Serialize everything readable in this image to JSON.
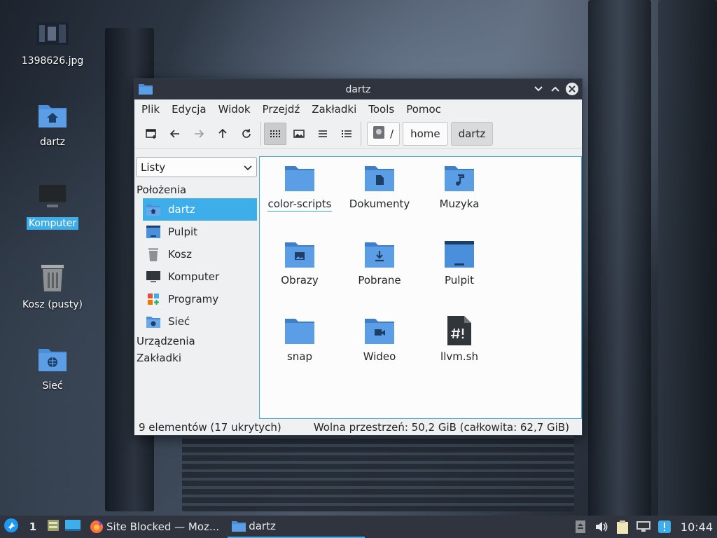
{
  "desktop": {
    "icons": [
      {
        "label": "1398626.jpg",
        "icon": "image-thumbnail-icon"
      },
      {
        "label": "dartz",
        "icon": "home-folder-icon"
      },
      {
        "label": "Komputer",
        "icon": "computer-icon",
        "selected": true
      },
      {
        "label": "Kosz (pusty)",
        "icon": "trash-icon"
      },
      {
        "label": "Sieć",
        "icon": "network-folder-icon"
      }
    ]
  },
  "window": {
    "title": "dartz",
    "menu": [
      "Plik",
      "Edycja",
      "Widok",
      "Przejdź",
      "Zakładki",
      "Tools",
      "Pomoc"
    ],
    "breadcrumb": [
      "/",
      "home",
      "dartz"
    ],
    "side_mode": "Listy",
    "side_sections": {
      "places": "Położenia",
      "devices": "Urządzenia",
      "bookmarks": "Zakładki"
    },
    "places": [
      {
        "label": "dartz",
        "icon": "home-folder-icon",
        "selected": true
      },
      {
        "label": "Pulpit",
        "icon": "desktop-icon"
      },
      {
        "label": "Kosz",
        "icon": "trash-icon"
      },
      {
        "label": "Komputer",
        "icon": "computer-icon"
      },
      {
        "label": "Programy",
        "icon": "applications-icon"
      },
      {
        "label": "Sieć",
        "icon": "network-icon"
      }
    ],
    "files": [
      {
        "name": "color-scripts",
        "icon": "folder-icon"
      },
      {
        "name": "Dokumenty",
        "icon": "documents-folder-icon"
      },
      {
        "name": "Muzyka",
        "icon": "music-folder-icon"
      },
      {
        "name": "Obrazy",
        "icon": "pictures-folder-icon"
      },
      {
        "name": "Pobrane",
        "icon": "downloads-folder-icon"
      },
      {
        "name": "Pulpit",
        "icon": "desktop-folder-icon"
      },
      {
        "name": "snap",
        "icon": "folder-icon"
      },
      {
        "name": "Wideo",
        "icon": "videos-folder-icon"
      },
      {
        "name": "llvm.sh",
        "icon": "shell-script-icon"
      }
    ],
    "status_left": "9 elementów (17 ukrytych)",
    "status_right": "Wolna przestrzeń: 50,2 GiB (całkowita: 62,7 GiB)"
  },
  "taskbar": {
    "workspace": "1",
    "tasks": [
      {
        "label": "Site Blocked — Moz...",
        "icon": "firefox-icon"
      },
      {
        "label": "dartz",
        "icon": "folder-icon",
        "active": true
      }
    ],
    "clock": "10:44"
  },
  "colors": {
    "accent": "#3daee9",
    "folder": "#4a8fdc",
    "titlebar": "#2f343f"
  }
}
